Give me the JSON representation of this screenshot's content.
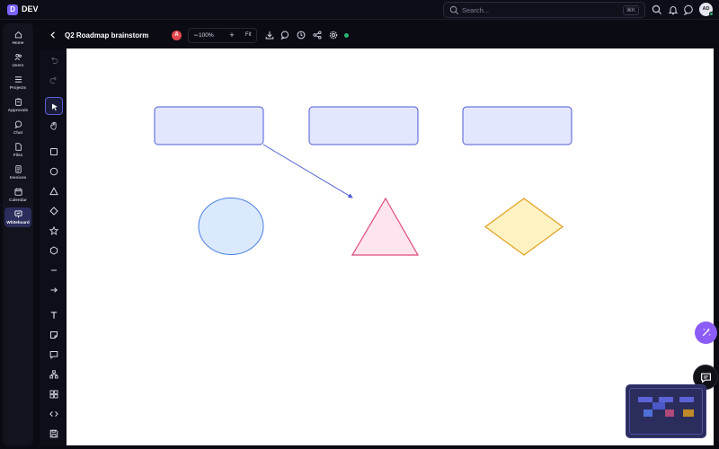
{
  "app": {
    "logo_letter": "D",
    "name": "DEV"
  },
  "search": {
    "placeholder": "Search...",
    "shortcut": "⌘K"
  },
  "user": {
    "initials": "AD"
  },
  "nav": {
    "items": [
      {
        "label": "Home",
        "icon": "home-icon"
      },
      {
        "label": "Users",
        "icon": "users-icon"
      },
      {
        "label": "Projects",
        "icon": "projects-icon"
      },
      {
        "label": "Approvals",
        "icon": "clipboard-icon"
      },
      {
        "label": "Chat",
        "icon": "chat-icon"
      },
      {
        "label": "Files",
        "icon": "file-icon"
      },
      {
        "label": "Invoices",
        "icon": "invoice-icon"
      },
      {
        "label": "Calendar",
        "icon": "calendar-icon"
      },
      {
        "label": "Whiteboard",
        "icon": "whiteboard-icon",
        "active": true
      }
    ]
  },
  "board": {
    "title": "Q2 Roadmap brainstorm",
    "collaborator_initial": "A",
    "zoom": "100%",
    "fit_label": "Fit",
    "zoom_out": "−",
    "zoom_in": "+"
  },
  "colors": {
    "accent": "#7b61ff",
    "rect_fill": "#e3e6ff",
    "rect_stroke": "#4c5bd4",
    "circle_fill": "#dbe9ff",
    "circle_stroke": "#4a7fe0",
    "triangle_fill": "#fde4ee",
    "triangle_stroke": "#e04a7a",
    "diamond_fill": "#fff2c2",
    "diamond_stroke": "#e0a020",
    "online": "#2bb673"
  }
}
